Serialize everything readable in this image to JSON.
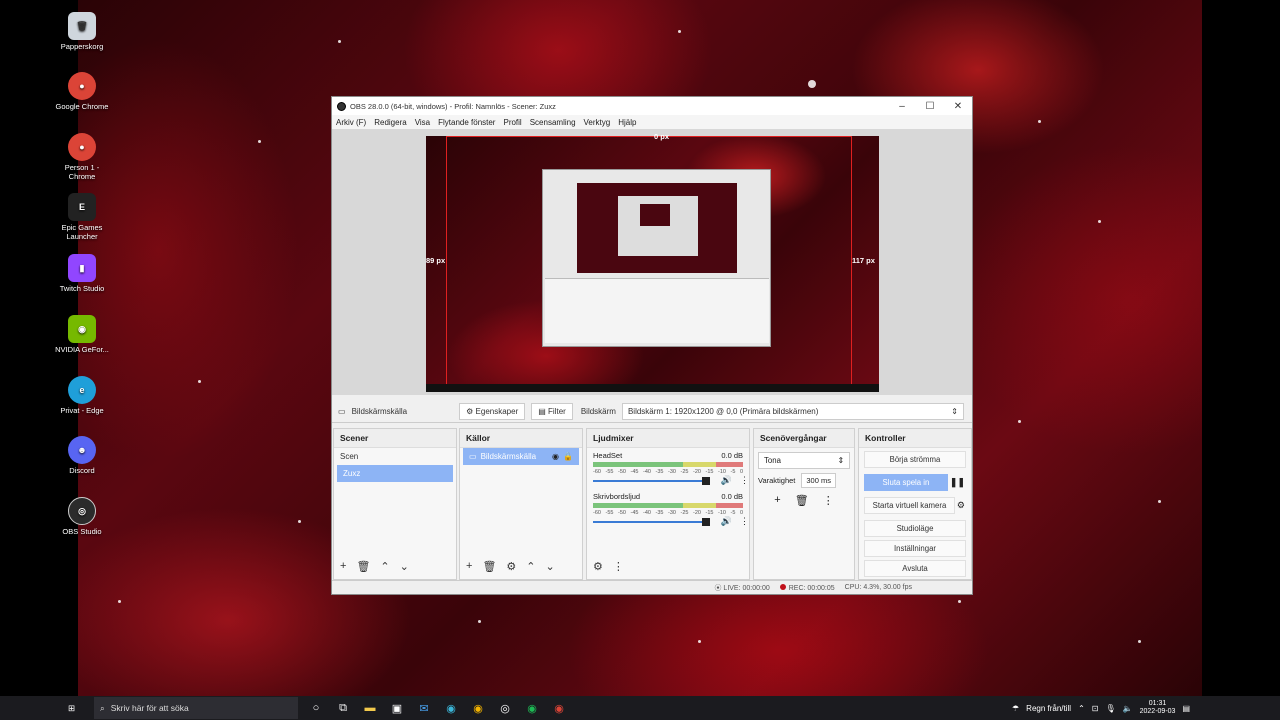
{
  "desktop_icons": [
    {
      "label": "Papperskorg",
      "icon": "recycle-bin-icon",
      "color": "#cfd6dd"
    },
    {
      "label": "Google Chrome",
      "icon": "chrome-icon",
      "color": "#db4437"
    },
    {
      "label": "Person 1 - Chrome",
      "icon": "chrome-icon",
      "color": "#db4437"
    },
    {
      "label": "Epic Games Launcher",
      "icon": "epic-games-icon",
      "color": "#222222"
    },
    {
      "label": "Twitch Studio",
      "icon": "twitch-icon",
      "color": "#9146ff"
    },
    {
      "label": "NVIDIA GeFor...",
      "icon": "nvidia-icon",
      "color": "#76b900"
    },
    {
      "label": "Privat - Edge",
      "icon": "edge-icon",
      "color": "#1f9fd9"
    },
    {
      "label": "Discord",
      "icon": "discord-icon",
      "color": "#5865f2"
    },
    {
      "label": "OBS Studio",
      "icon": "obs-icon",
      "color": "#2b2b2b"
    }
  ],
  "window": {
    "title": "OBS 28.0.0 (64-bit, windows) - Profil: Namnlös - Scener: Zuxz",
    "menu": [
      "Arkiv (F)",
      "Redigera",
      "Visa",
      "Flytande fönster",
      "Profil",
      "Scensamling",
      "Verktyg",
      "Hjälp"
    ]
  },
  "preview": {
    "top_px": "0 px",
    "left_px": "89 px",
    "right_px": "117 px"
  },
  "source_bar": {
    "source_name": "Bildskärmskälla",
    "properties": "Egenskaper",
    "filter": "Filter",
    "display_label": "Bildskärm",
    "display_value": "Bildskärm 1: 1920x1200 @ 0,0 (Primära bildskärmen)"
  },
  "scenes": {
    "title": "Scener",
    "items": [
      "Scen",
      "Zuxz"
    ],
    "active": "Zuxz"
  },
  "sources": {
    "title": "Källor",
    "items": [
      "Bildskärmskälla"
    ]
  },
  "mixer": {
    "title": "Ljudmixer",
    "channels": [
      {
        "name": "HeadSet",
        "db": "0.0 dB"
      },
      {
        "name": "Skrivbordsljud",
        "db": "0.0 dB"
      }
    ],
    "ticks": [
      "-60",
      "-55",
      "-50",
      "-45",
      "-40",
      "-35",
      "-30",
      "-25",
      "-20",
      "-15",
      "-10",
      "-5",
      "0"
    ]
  },
  "transitions": {
    "title": "Scenövergångar",
    "type": "Tona",
    "duration_label": "Varaktighet",
    "duration": "300 ms"
  },
  "controls": {
    "title": "Kontroller",
    "start_stream": "Börja strömma",
    "stop_record": "Sluta spela in",
    "virtual_cam": "Starta virtuell kamera",
    "studio_mode": "Studioläge",
    "settings": "Inställningar",
    "exit": "Avsluta"
  },
  "status": {
    "live": "LIVE: 00:00:00",
    "rec": "REC: 00:00:05",
    "cpu": "CPU: 4.3%, 30.00 fps"
  },
  "taskbar": {
    "search_placeholder": "Skriv här för att söka",
    "weather": "Regn från/till",
    "time": "01:31",
    "date": "2022-09-03"
  }
}
